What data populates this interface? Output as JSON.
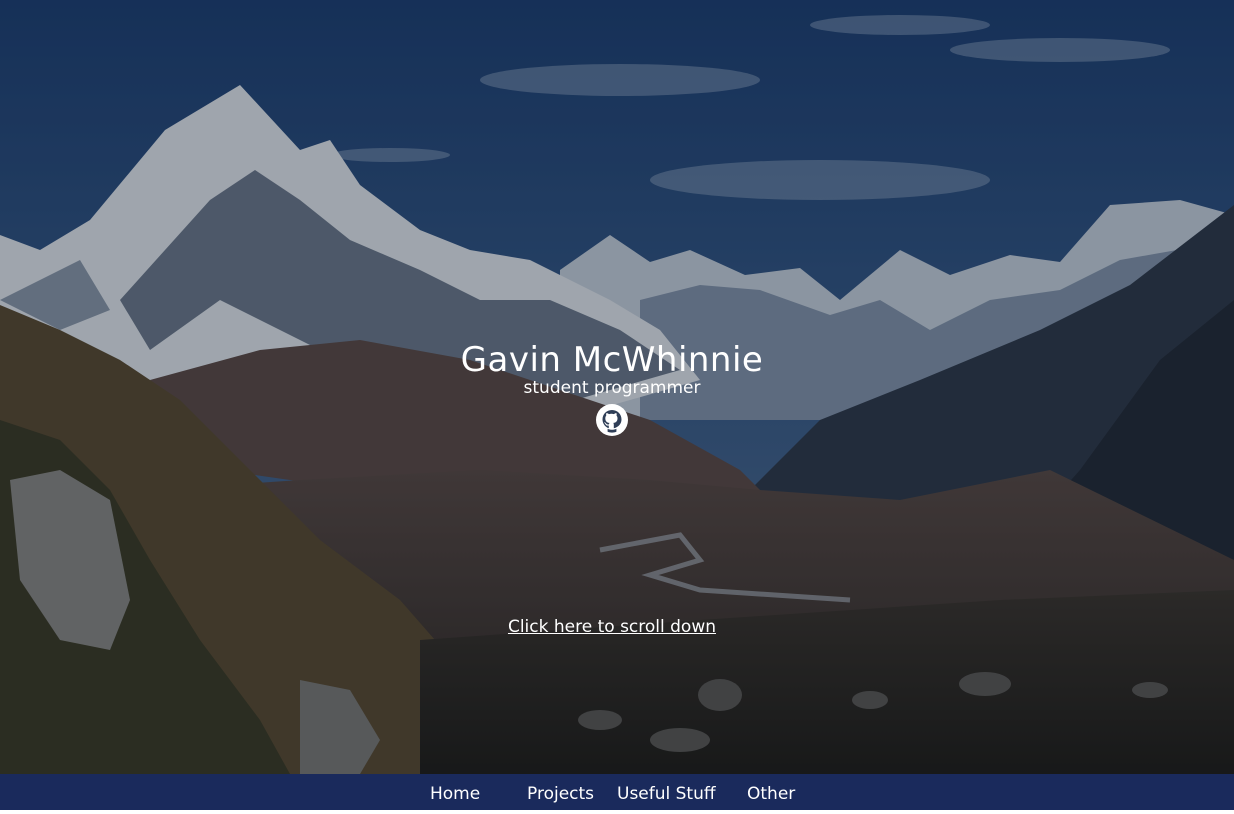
{
  "hero": {
    "name": "Gavin McWhinnie",
    "tagline": "student programmer",
    "icon": "github-icon",
    "scroll_link": "Click here to scroll down"
  },
  "nav": {
    "items": [
      {
        "label": "Home"
      },
      {
        "label": "Projects"
      },
      {
        "label": "Useful Stuff"
      },
      {
        "label": "Other"
      }
    ]
  },
  "colors": {
    "nav_background": "#1a2a5c",
    "sky": "#27476f",
    "text": "#ffffff"
  }
}
